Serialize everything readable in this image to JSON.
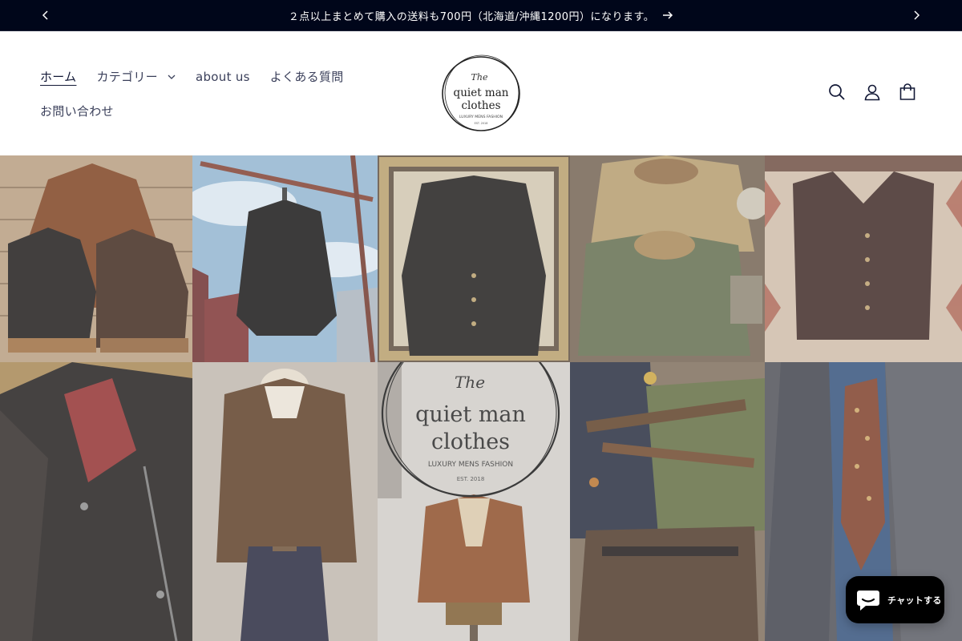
{
  "announcement": {
    "message": "２点以上まとめて購入の送料も700円（北海道/沖縄1200円）になります。",
    "prev_icon": "chevron-left-icon",
    "next_icon": "chevron-right-icon",
    "arrow_icon": "arrow-right-icon"
  },
  "nav": {
    "items": [
      {
        "label": "ホーム",
        "active": true
      },
      {
        "label": "カテゴリー",
        "has_dropdown": true
      },
      {
        "label": "about us"
      },
      {
        "label": "よくある質問"
      },
      {
        "label": "お問い合わせ"
      }
    ]
  },
  "logo": {
    "script": "The",
    "line1": "quiet man",
    "line2": "clothes",
    "tagline": "LUXURY MENS FASHION",
    "est": "EST. 2018"
  },
  "header_icons": {
    "search": "search-icon",
    "account": "account-icon",
    "cart": "cart-icon"
  },
  "gallery": {
    "center_logo": {
      "script": "The",
      "line1": "quiet man",
      "line2": "clothes",
      "tagline": "LUXURY MENS FASHION",
      "est": "EST. 2018"
    }
  },
  "chat": {
    "label": "チャットする",
    "icon": "chat-bubble-icon"
  },
  "colors": {
    "announcement_bg": "#00061a",
    "nav_text": "#3a3f5a",
    "chat_bg": "#000000"
  }
}
